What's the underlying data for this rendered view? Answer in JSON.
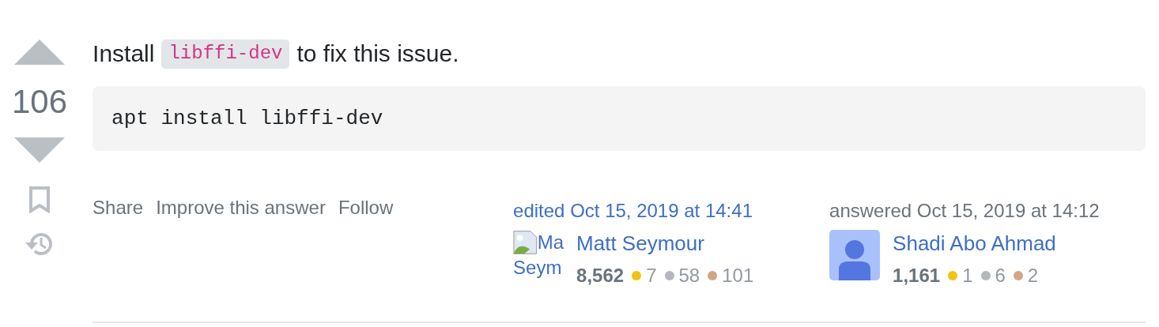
{
  "vote": {
    "score": "106",
    "bookmarked": false
  },
  "answer": {
    "intro": "Install",
    "inline_code": "libffi-dev",
    "outro": "to fix this issue.",
    "code_block": "apt install libffi-dev"
  },
  "actions": [
    "Share",
    "Improve this answer",
    "Follow"
  ],
  "editor": {
    "action": "edited Oct 15, 2019 at 14:41",
    "avatar": {
      "kind": "broken",
      "alt_lines": [
        "Ma",
        "Seym"
      ]
    },
    "name": "Matt Seymour",
    "reputation": "8,562",
    "badges": [
      {
        "count": "7",
        "color": "#f1c40f"
      },
      {
        "count": "58",
        "color": "#b4b8bc"
      },
      {
        "count": "101",
        "color": "#d1a684"
      }
    ]
  },
  "author": {
    "action": "answered Oct 15, 2019 at 14:12",
    "avatar": {
      "kind": "silhouette"
    },
    "name": "Shadi Abo Ahmad",
    "reputation": "1,161",
    "badges": [
      {
        "count": "1",
        "color": "#f1c40f"
      },
      {
        "count": "6",
        "color": "#b4b8bc"
      },
      {
        "count": "2",
        "color": "#d1a684"
      }
    ]
  }
}
